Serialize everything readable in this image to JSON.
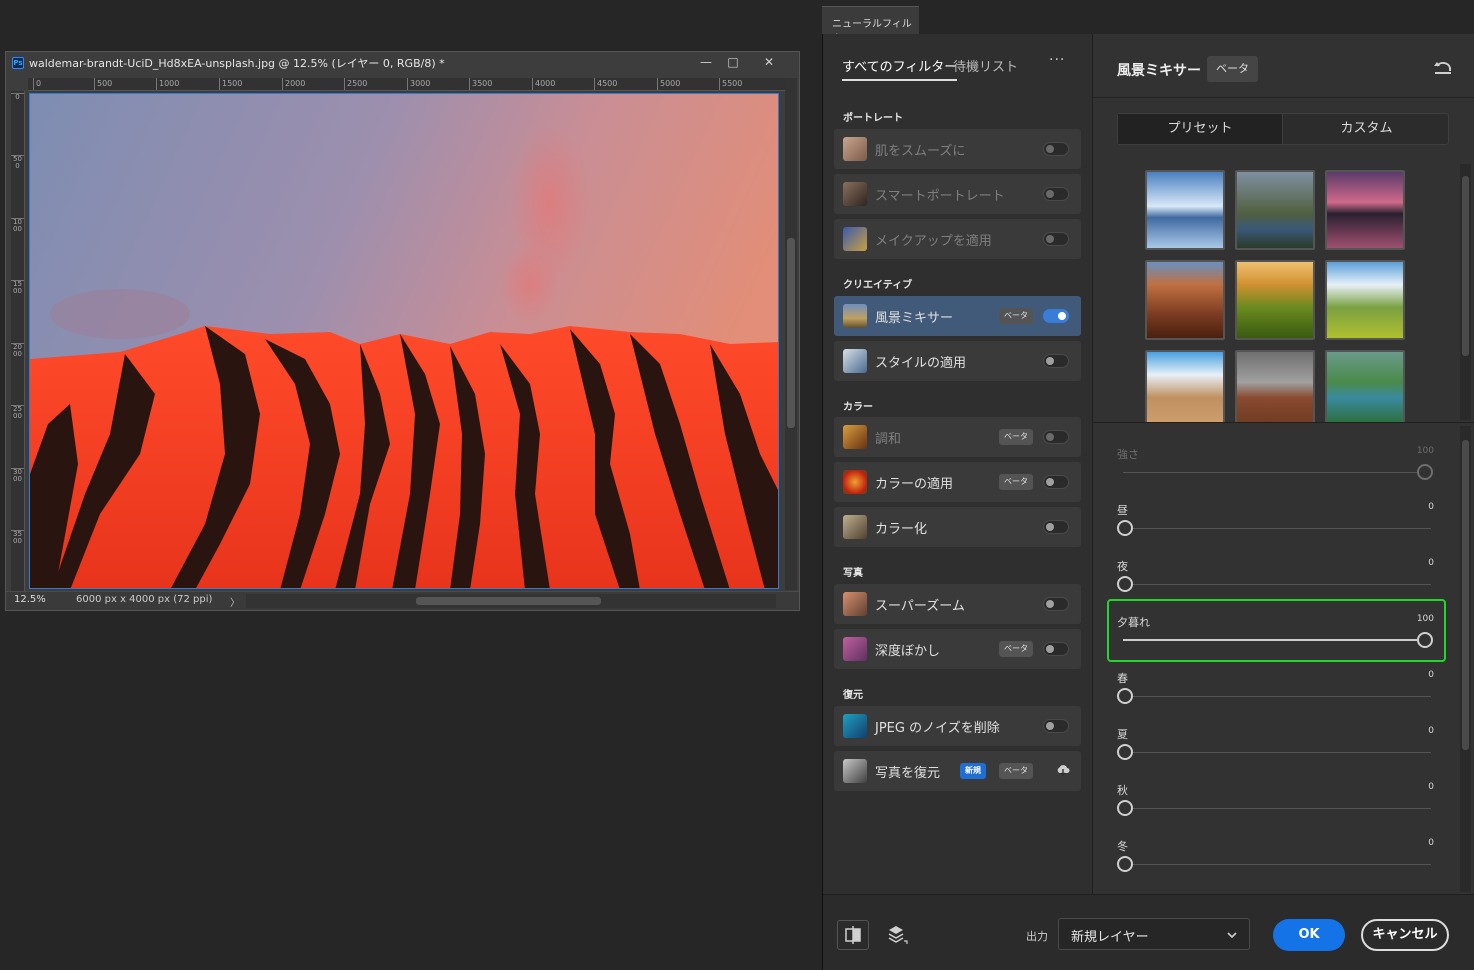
{
  "document": {
    "title": "waldemar-brandt-UciD_Hd8xEA-unsplash.jpg @ 12.5% (レイヤー 0, RGB/8) *",
    "ps_badge": "Ps",
    "window_buttons": {
      "minimize": "—",
      "restore": "□",
      "close": "✕"
    },
    "ruler_h": [
      "0",
      "500",
      "1000",
      "1500",
      "2000",
      "2500",
      "3000",
      "3500",
      "4000",
      "4500",
      "5000",
      "5500"
    ],
    "ruler_v": [
      "0",
      "500",
      "1000",
      "1500",
      "2000",
      "2500",
      "3000",
      "3500"
    ],
    "zoom": "12.5%",
    "dimensions": "6000 px x 4000 px (72 ppi)",
    "status_arrow": "〉"
  },
  "neural_filters": {
    "tab_label": "ニューラルフィルター",
    "tabs": {
      "all": "すべてのフィルター",
      "waitlist": "待機リスト"
    },
    "more": "···",
    "categories": {
      "portrait": "ポートレート",
      "creative": "クリエイティブ",
      "color": "カラー",
      "photo": "写真",
      "restore": "復元"
    },
    "filters": {
      "smooth_skin": {
        "name": "肌をスムーズに"
      },
      "smart_portrait": {
        "name": "スマートポートレート"
      },
      "makeup": {
        "name": "メイクアップを適用"
      },
      "landscape_mixer": {
        "name": "風景ミキサー",
        "badge": "ベータ"
      },
      "style_transfer": {
        "name": "スタイルの適用"
      },
      "harmonize": {
        "name": "調和",
        "badge": "ベータ"
      },
      "color_transfer": {
        "name": "カラーの適用",
        "badge": "ベータ"
      },
      "colorize": {
        "name": "カラー化"
      },
      "super_zoom": {
        "name": "スーパーズーム"
      },
      "depth_blur": {
        "name": "深度ぼかし",
        "badge": "ベータ"
      },
      "jpeg_artifacts": {
        "name": "JPEG のノイズを削除"
      },
      "photo_restore": {
        "name": "写真を復元",
        "badge_new": "新規",
        "badge": "ベータ"
      }
    },
    "detail": {
      "title": "風景ミキサー",
      "badge": "ベータ",
      "segments": {
        "preset": "プリセット",
        "custom": "カスタム"
      },
      "sliders": [
        {
          "label": "強さ",
          "value": "100"
        },
        {
          "label": "昼",
          "value": "0"
        },
        {
          "label": "夜",
          "value": "0"
        },
        {
          "label": "夕暮れ",
          "value": "100"
        },
        {
          "label": "春",
          "value": "0"
        },
        {
          "label": "夏",
          "value": "0"
        },
        {
          "label": "秋",
          "value": "0"
        },
        {
          "label": "冬",
          "value": "0"
        }
      ]
    },
    "footer": {
      "output_label": "出力",
      "output_value": "新規レイヤー",
      "ok": "OK",
      "cancel": "キャンセル"
    }
  },
  "colors": {
    "accent": "#1473e6",
    "highlight": "#24d62c",
    "active_row": "#415a7a"
  }
}
